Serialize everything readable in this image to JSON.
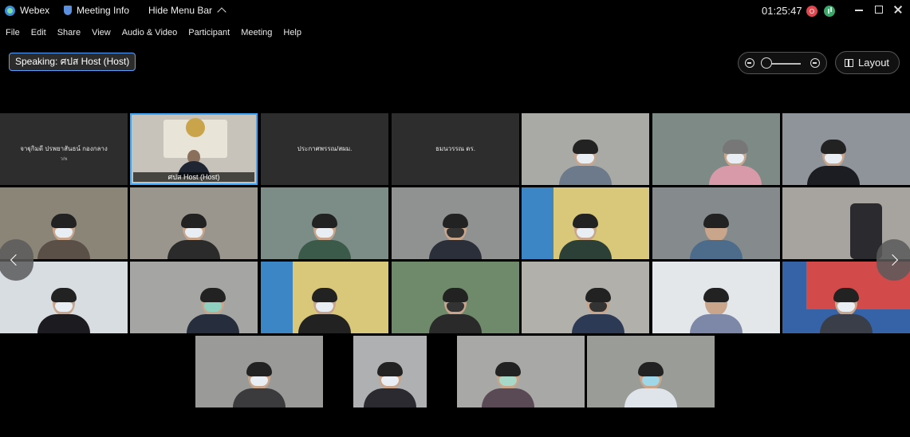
{
  "titlebar": {
    "app_name": "Webex",
    "meeting_info": "Meeting Info",
    "hide_menu": "Hide Menu Bar",
    "clock": "01:25:47",
    "rec_badge": "O"
  },
  "menu": [
    "File",
    "Edit",
    "Share",
    "View",
    "Audio & Video",
    "Participant",
    "Meeting",
    "Help"
  ],
  "speaking": "Speaking: ศปส Host (Host)",
  "layout_label": "Layout",
  "name_tiles": [
    {
      "name": "จาฐุกิมดี ปรพยาสันธน์ กองกลาง",
      "sub": "ว/พ"
    },
    {
      "name": "ประกาศพรรณ/สผม.",
      "sub": ""
    },
    {
      "name": "ธมนวรรณ ดร.",
      "sub": ""
    }
  ],
  "host_tile_label": "ศปส Host (Host)",
  "colors": {
    "accent_blue": "#3aa7ff",
    "record_red": "#e0464e",
    "network_green": "#3aa86a",
    "tile_background": "#2d2d2d"
  }
}
